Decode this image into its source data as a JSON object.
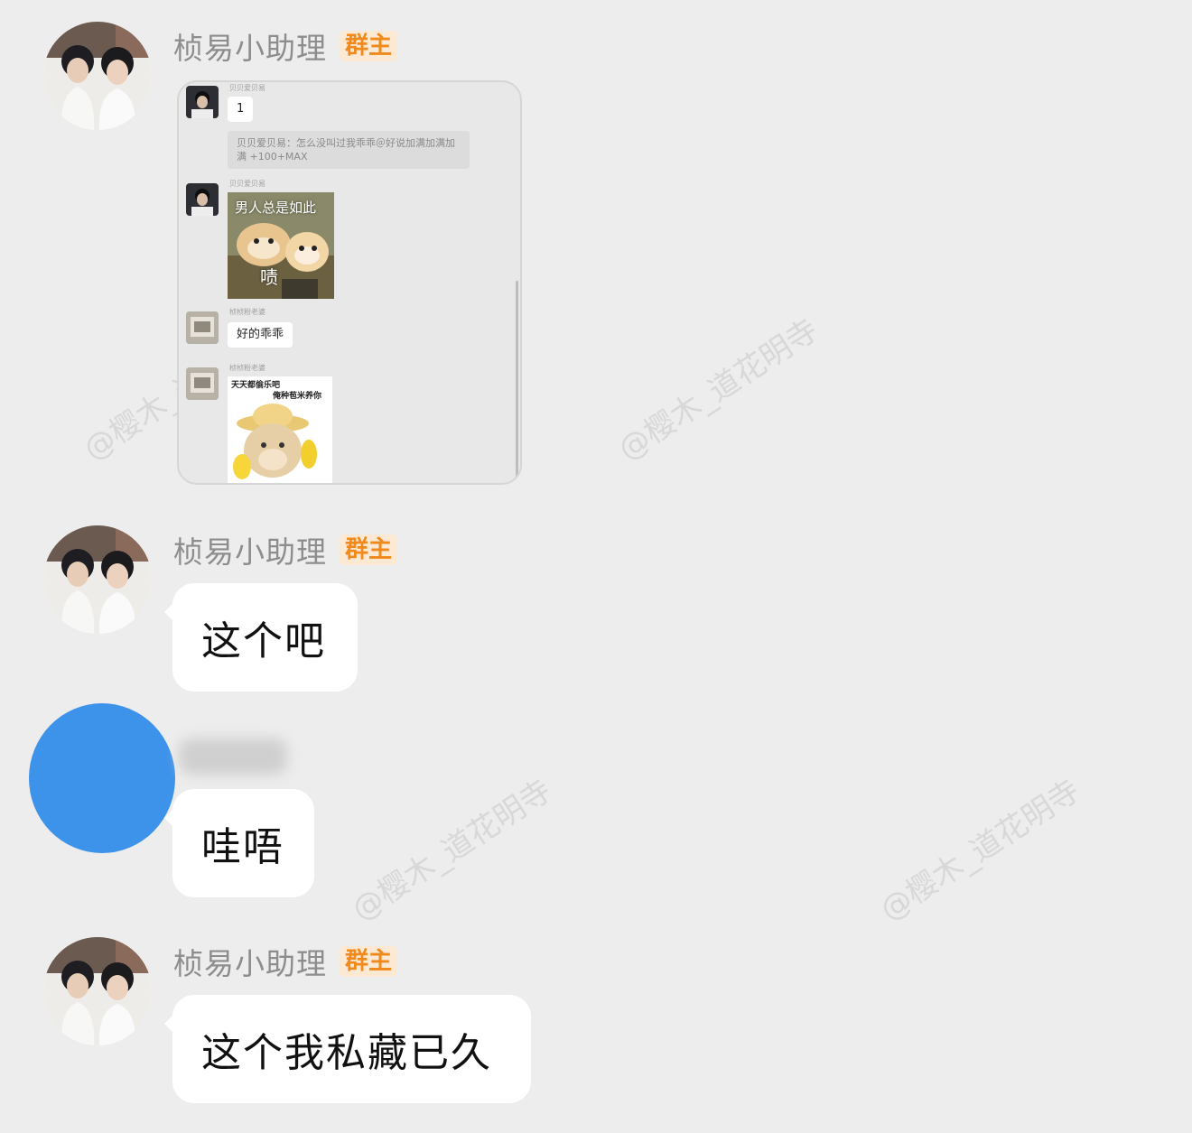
{
  "colors": {
    "background": "#ededed",
    "bubble": "#ffffff",
    "badge_bg": "#fbe9d3",
    "badge_text": "#f08a1c",
    "sender_name": "#8d8d8d",
    "blue_avatar": "#3d92ea"
  },
  "messages": [
    {
      "sender": "桢易小助理",
      "badge": "群主",
      "type": "image",
      "screenshot": {
        "items": [
          {
            "name": "贝贝爱贝易",
            "text": "1"
          },
          {
            "quote": "贝贝爱贝易：怎么没叫过我乖乖＠好说加满加满加满 +100+MAX"
          },
          {
            "name": "贝贝爱贝易",
            "sticker_top": "男人总是如此",
            "sticker_bottom": "啧"
          },
          {
            "name": "桢桢粉老婆",
            "text": "好的乖乖"
          },
          {
            "name": "桢桢粉老婆",
            "sticker_top": "天天都偷乐吧",
            "sticker_sub": "俺种苞米养你"
          }
        ]
      }
    },
    {
      "sender": "桢易小助理",
      "badge": "群主",
      "type": "text",
      "text": "这个吧"
    },
    {
      "sender": "",
      "type": "text",
      "text": "哇唔"
    },
    {
      "sender": "桢易小助理",
      "badge": "群主",
      "type": "text",
      "text": "这个我私藏已久"
    }
  ],
  "watermarks": [
    "@樱木_道花明寺",
    "@樱木_道花明寺",
    "@樱木_道花明寺",
    "@樱木_道花明寺"
  ]
}
